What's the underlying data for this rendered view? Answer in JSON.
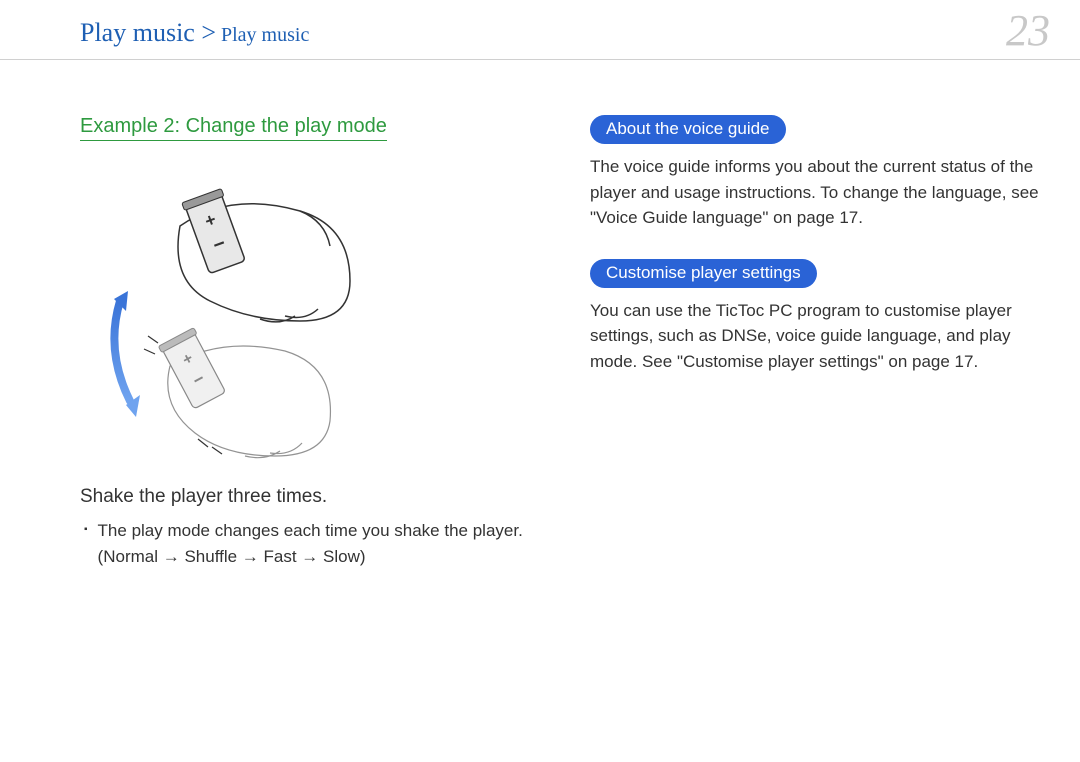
{
  "header": {
    "breadcrumb_main": "Play music >",
    "breadcrumb_sub": " Play music",
    "page_number": "23"
  },
  "left": {
    "title": "Example 2: Change the play mode",
    "instruction": "Shake the player three times.",
    "bullet": "The play mode changes each time you shake the player. (Normal → Shuffle → Fast → Slow)"
  },
  "right": {
    "pill1": "About the voice guide",
    "body1": "The voice guide informs you about the current status of the player and usage instructions. To change the language, see \"Voice Guide language\" on page 17.",
    "pill2": "Customise player settings",
    "body2": "You can use the TicToc PC program to customise player settings, such as DNSe, voice guide language, and play mode. See \"Customise player settings\" on page 17."
  }
}
